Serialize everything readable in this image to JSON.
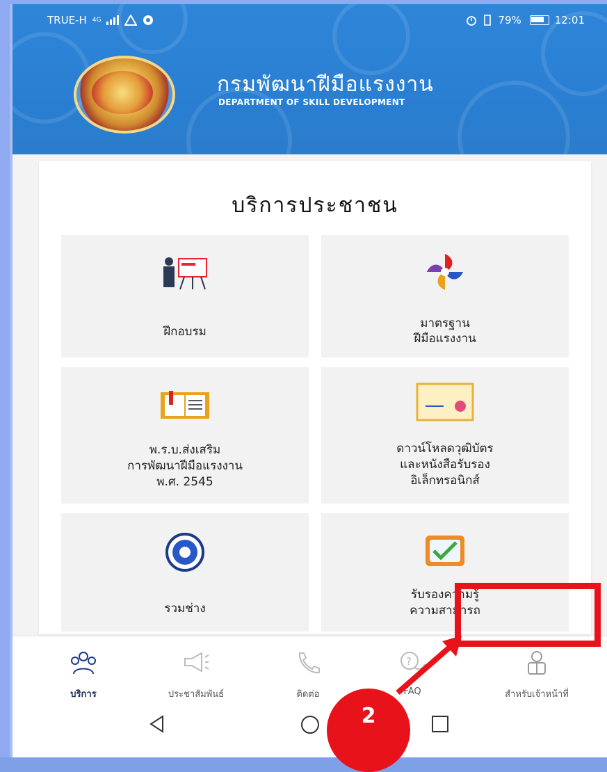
{
  "status_bar": {
    "carrier": "TRUE-H",
    "network": "4G",
    "battery": "79%",
    "time": "12:01"
  },
  "header": {
    "title_thai": "กรมพัฒนาฝีมือแรงงาน",
    "title_english": "DEPARTMENT OF SKILL DEVELOPMENT"
  },
  "card": {
    "title": "บริการประชาชน",
    "tiles": [
      {
        "label_line1": "ฝึกอบรม",
        "label_line2": "",
        "label_line3": "",
        "icon": "trainer-icon"
      },
      {
        "label_line1": "มาตรฐาน",
        "label_line2": "ฝีมือแรงงาน",
        "label_line3": "",
        "icon": "standard-emblem-icon"
      },
      {
        "label_line1": "พ.ร.บ.ส่งเสริม",
        "label_line2": "การพัฒนาฝีมือแรงงาน",
        "label_line3": "พ.ศ. 2545",
        "icon": "book-icon"
      },
      {
        "label_line1": "ดาวน์โหลดวุฒิบัตร",
        "label_line2": "และหนังสือรับรอง",
        "label_line3": "อิเล็กทรอนิกส์",
        "icon": "certificate-icon"
      },
      {
        "label_line1": "รวมช่าง",
        "label_line2": "",
        "label_line3": "",
        "icon": "technician-seal-icon"
      },
      {
        "label_line1": "รับรองความรู้",
        "label_line2": "ความสามารถ",
        "label_line3": "",
        "icon": "checkmark-document-icon"
      }
    ]
  },
  "bottom_nav": {
    "items": [
      {
        "label": "บริการ",
        "icon": "people-group-icon",
        "active": true
      },
      {
        "label": "ประชาสัมพันธ์",
        "icon": "megaphone-icon",
        "active": false
      },
      {
        "label": "ติดต่อ",
        "icon": "phone-icon",
        "active": false
      },
      {
        "label": "FAQ",
        "icon": "question-chat-icon",
        "active": false
      },
      {
        "label": "สำหรับเจ้าหน้าที่",
        "icon": "officer-icon",
        "active": false
      }
    ]
  },
  "annotation": {
    "step_number": "2",
    "highlight_color": "#e8131a"
  },
  "colors": {
    "header_blue": "#2f86d9",
    "tile_bg": "#f2f2f2",
    "accent_red": "#e8131a"
  }
}
